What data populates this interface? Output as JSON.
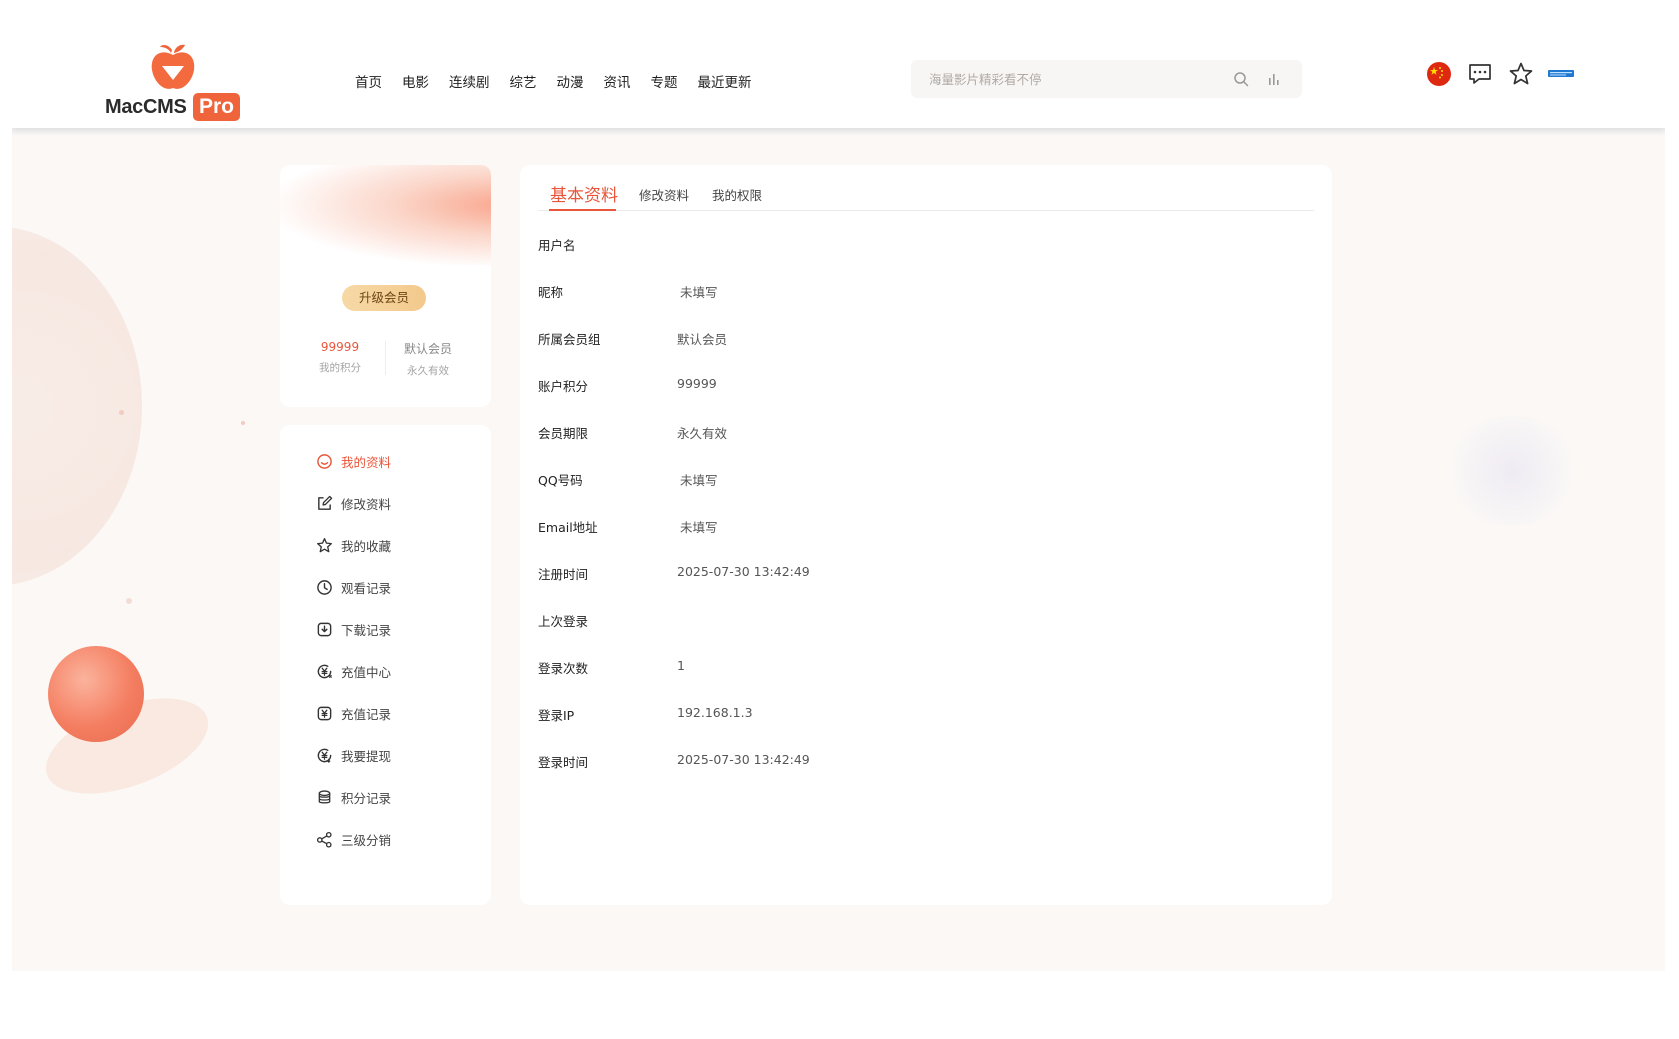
{
  "brand": {
    "logo_text": "MacCMS",
    "logo_badge": "Pro",
    "accent": "#e8553a"
  },
  "nav": {
    "items": [
      {
        "label": "首页"
      },
      {
        "label": "电影"
      },
      {
        "label": "连续剧"
      },
      {
        "label": "综艺"
      },
      {
        "label": "动漫"
      },
      {
        "label": "资讯"
      },
      {
        "label": "专题"
      },
      {
        "label": "最近更新"
      }
    ]
  },
  "search": {
    "placeholder": "海量影片精彩看不停",
    "icon": "search-icon"
  },
  "header_icons": [
    "language-flag-icon",
    "message-icon",
    "favorite-star-icon",
    "partner-badge-icon"
  ],
  "profile": {
    "upgrade_label": "升级会员",
    "points_value": "99999",
    "points_label": "我的积分",
    "group_value": "默认会员",
    "group_label": "永久有效"
  },
  "side_menu": {
    "items": [
      {
        "label": "我的资料",
        "icon": "smile-icon",
        "active": true
      },
      {
        "label": "修改资料",
        "icon": "edit-icon"
      },
      {
        "label": "我的收藏",
        "icon": "star-icon"
      },
      {
        "label": "观看记录",
        "icon": "clock-icon"
      },
      {
        "label": "下载记录",
        "icon": "download-icon"
      },
      {
        "label": "充值中心",
        "icon": "recharge-icon"
      },
      {
        "label": "充值记录",
        "icon": "yuan-icon"
      },
      {
        "label": "我要提现",
        "icon": "withdraw-icon"
      },
      {
        "label": "积分记录",
        "icon": "database-icon"
      },
      {
        "label": "三级分销",
        "icon": "share-icon"
      }
    ]
  },
  "tabs": [
    {
      "label": "基本资料",
      "active": true
    },
    {
      "label": "修改资料"
    },
    {
      "label": "我的权限"
    }
  ],
  "info": [
    {
      "key": "用户名",
      "value": ""
    },
    {
      "key": "昵称",
      "value": "未填写"
    },
    {
      "key": "所属会员组",
      "value": "默认会员"
    },
    {
      "key": "账户积分",
      "value": "99999"
    },
    {
      "key": "会员期限",
      "value": "永久有效"
    },
    {
      "key": "QQ号码",
      "value": "未填写"
    },
    {
      "key": "Email地址",
      "value": "未填写"
    },
    {
      "key": "注册时间",
      "value": "2025-07-30 13:42:49"
    },
    {
      "key": "上次登录",
      "value": ""
    },
    {
      "key": "登录次数",
      "value": "1"
    },
    {
      "key": "登录IP",
      "value": "192.168.1.3"
    },
    {
      "key": "登录时间",
      "value": "2025-07-30 13:42:49"
    }
  ]
}
